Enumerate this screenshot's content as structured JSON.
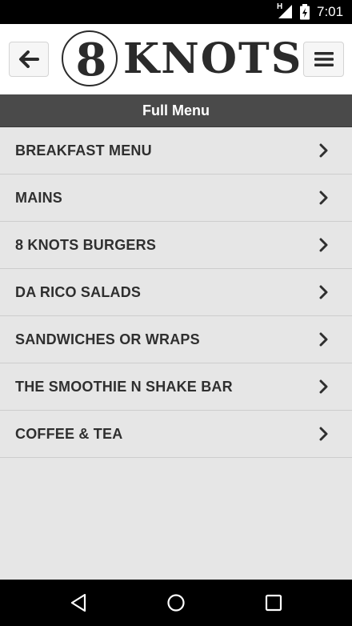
{
  "status_bar": {
    "network_label": "H",
    "time": "7:01"
  },
  "header": {
    "logo_number": "8",
    "logo_word": "KNOTS",
    "back_icon": "arrow-left-icon",
    "menu_icon": "hamburger-icon"
  },
  "page": {
    "title": "Full Menu"
  },
  "menu": {
    "items": [
      {
        "label": "BREAKFAST MENU"
      },
      {
        "label": "MAINS"
      },
      {
        "label": "8 KNOTS BURGERS"
      },
      {
        "label": "DA RICO SALADS"
      },
      {
        "label": "SANDWICHES OR WRAPS"
      },
      {
        "label": "THE SMOOTHIE N SHAKE BAR"
      },
      {
        "label": "COFFEE & TEA"
      }
    ]
  },
  "nav_bar": {
    "icons": [
      "back-triangle-icon",
      "home-circle-icon",
      "recents-square-icon"
    ]
  },
  "colors": {
    "title_bar": "#4a4a4a",
    "list_bg": "#e6e6e6",
    "text": "#2f2f2f"
  }
}
